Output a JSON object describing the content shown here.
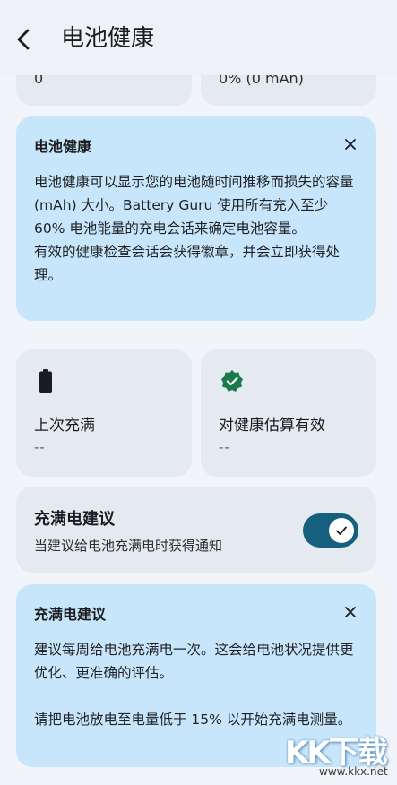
{
  "header": {
    "title": "电池健康"
  },
  "top_cards": {
    "left_value": "0",
    "right_value": "0% (0 mAh)"
  },
  "battery_health_info": {
    "title": "电池健康",
    "body": "电池健康可以显示您的电池随时间推移而损失的容量 (mAh) 大小。Battery Guru 使用所有充入至少 60% 电池能量的充电会话来确定电池容量。\n有效的健康检查会话会获得徽章，并会立即获得处理。"
  },
  "stats": {
    "last_full": {
      "label": "上次充满",
      "value": "--"
    },
    "valid_estimate": {
      "label": "对健康估算有效",
      "value": "--"
    }
  },
  "full_charge_setting": {
    "title": "充满电建议",
    "subtitle": "当建议给电池充满电时获得通知",
    "enabled": true
  },
  "full_charge_info": {
    "title": "充满电建议",
    "body": "建议每周给电池充满电一次。这会给电池状况提供更优化、更准确的评估。\n\n请把电池放电至电量低于 15% 以开始充满电测量。"
  },
  "watermark": {
    "text": "KK下载",
    "url": "www.kkx.net"
  },
  "colors": {
    "accent": "#15607e",
    "info_card": "#c8e6fb",
    "grey_card": "#e5e9f0",
    "check_badge": "#1a7a4c"
  }
}
